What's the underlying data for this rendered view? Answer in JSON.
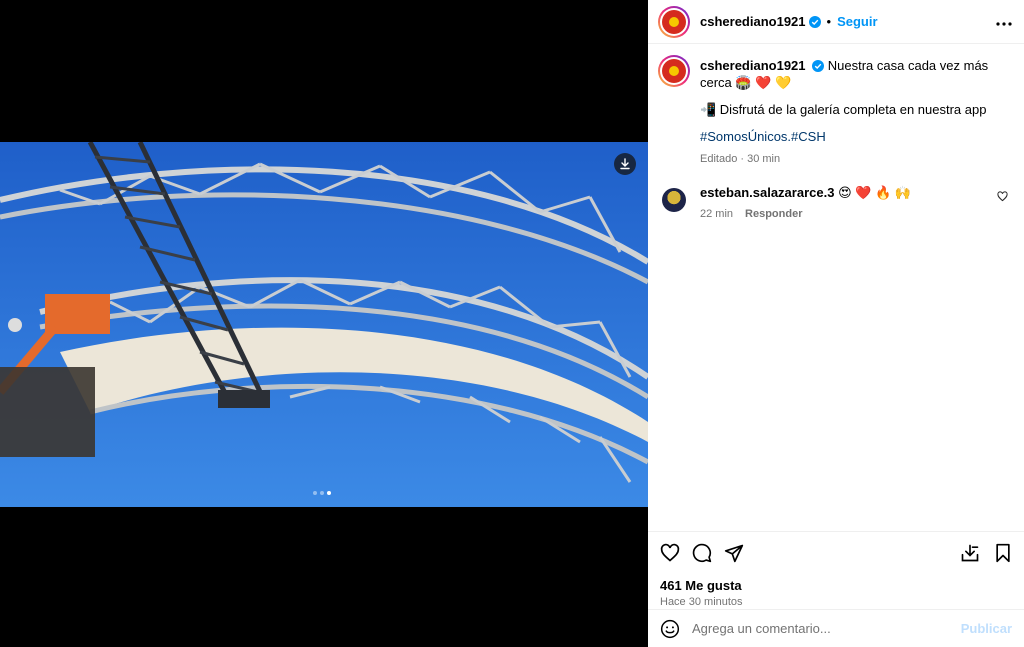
{
  "post": {
    "username": "csherediano1921",
    "follow_label": "Seguir",
    "separator": "•",
    "caption_main": "Nuestra casa cada vez más cerca 🏟️ ❤️ 💛",
    "caption_line2": "📲 Disfrutá de la galería completa en nuestra app",
    "hashtags": "#SomosÚnicos.#CSH",
    "edited": "Editado · 30 min"
  },
  "comments": [
    {
      "username": "esteban.salazararce.3",
      "text": "😍 ❤️ 🔥 🙌",
      "time": "22 min",
      "reply_label": "Responder"
    }
  ],
  "stats": {
    "likes": "461 Me gusta",
    "posted": "Hace 30 minutos"
  },
  "comment_box": {
    "placeholder": "Agrega un comentario...",
    "publish_label": "Publicar"
  },
  "carousel": {
    "count": 3,
    "active_index": 2
  },
  "icons": [
    "download-icon",
    "verified-icon",
    "more-icon",
    "heart-icon",
    "comment-icon",
    "share-icon",
    "save-to-collection-icon",
    "bookmark-icon",
    "emoji-icon"
  ],
  "colors": {
    "accent": "#0095f6",
    "hashtag": "#00376b",
    "muted": "#737373",
    "sky": "#2f74d6",
    "publish_disabled": "#c0dffd"
  }
}
